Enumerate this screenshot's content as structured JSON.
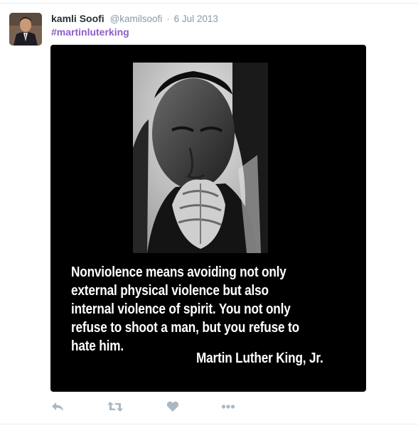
{
  "tweet": {
    "display_name": "kamli Soofi",
    "handle": "@kamilsoofi",
    "separator": "·",
    "date": "6 Jul 2013",
    "hashtag": "#martinluterking"
  },
  "media": {
    "quote_lines": [
      "Nonviolence means avoiding not only",
      "external physical violence but also",
      "internal violence of spirit. You not only",
      "refuse to shoot a man, but you refuse to",
      "hate him."
    ],
    "author": "Martin Luther King, Jr."
  },
  "actions": [
    {
      "icon": "reply-icon"
    },
    {
      "icon": "retweet-icon"
    },
    {
      "icon": "like-heart-icon"
    },
    {
      "icon": "more-dots-icon"
    }
  ],
  "colors": {
    "name": "#292f33",
    "meta": "#8899a6",
    "hashtag": "#8f5cc8",
    "action_icon": "#aab8c2",
    "media_bg": "#000000"
  }
}
